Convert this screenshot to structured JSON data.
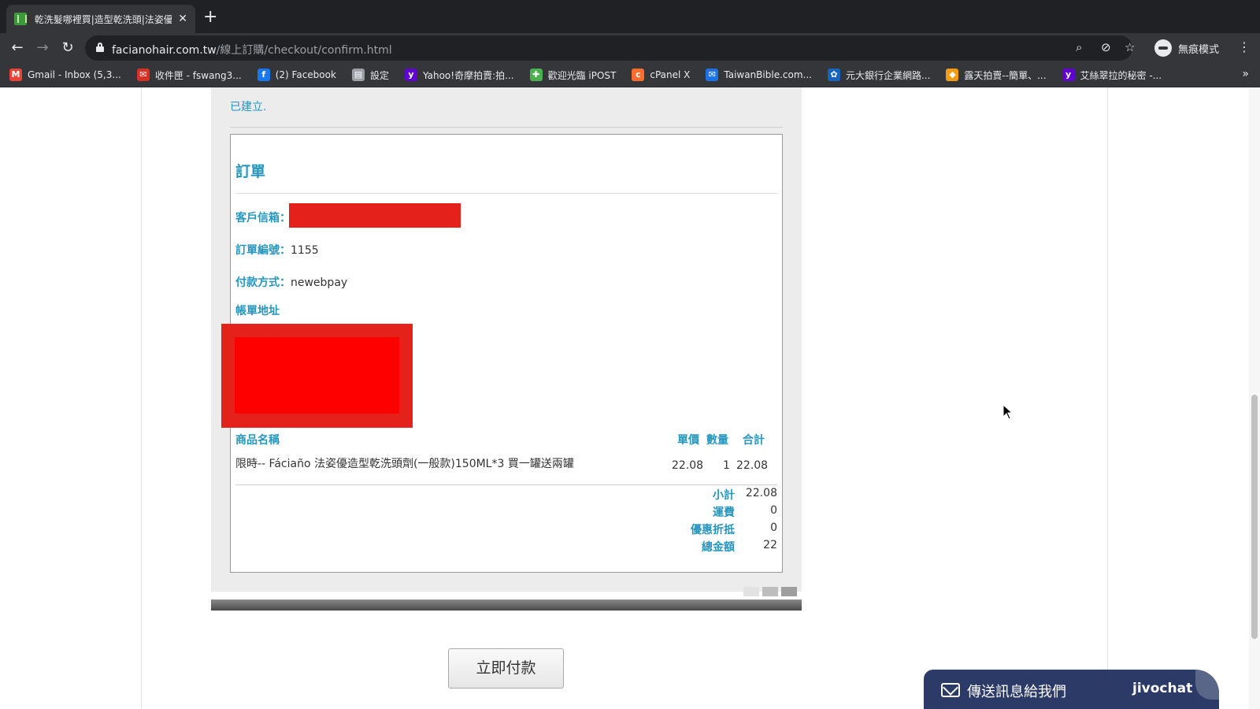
{
  "browser": {
    "tab": {
      "title": "乾洗髮哪裡買|造型乾洗頭|法姿優",
      "close": "✕"
    },
    "new_tab": "+",
    "url": {
      "host": "facianohair.com.tw",
      "path": "/線上訂購/checkout/confirm.html"
    },
    "profile_label": "無痕模式",
    "bookmarks": [
      {
        "label": "Gmail - Inbox (5,3...",
        "icon": "gmail-icon",
        "color": "#ea4335",
        "glyph": "M"
      },
      {
        "label": "收件匣 - fswang3...",
        "icon": "mail-icon",
        "color": "#d93025",
        "glyph": "✉"
      },
      {
        "label": "(2) Facebook",
        "icon": "facebook-icon",
        "color": "#1877f2",
        "glyph": "f"
      },
      {
        "label": "設定",
        "icon": "printer-icon",
        "color": "#9aa0a6",
        "glyph": "▤"
      },
      {
        "label": "Yahoo!奇摩拍賣:拍...",
        "icon": "yahoo-icon",
        "color": "#6001d2",
        "glyph": "y"
      },
      {
        "label": "歡迎光臨 iPOST",
        "icon": "ipost-icon",
        "color": "#4caf50",
        "glyph": "✚"
      },
      {
        "label": "cPanel X",
        "icon": "cpanel-icon",
        "color": "#ff6c2c",
        "glyph": "c"
      },
      {
        "label": "TaiwanBible.com...",
        "icon": "taiwanbible-icon",
        "color": "#1a73e8",
        "glyph": "✉"
      },
      {
        "label": "元大銀行企業網路...",
        "icon": "bank-icon",
        "color": "#1565c0",
        "glyph": "✿"
      },
      {
        "label": "露天拍賣--簡單、...",
        "icon": "ruten-icon",
        "color": "#f39c12",
        "glyph": "◆"
      },
      {
        "label": "艾絲翠拉的秘密 -...",
        "icon": "yahoo-icon",
        "color": "#6001d2",
        "glyph": "y"
      }
    ]
  },
  "page": {
    "status_text": "已建立.",
    "order": {
      "title": "訂單",
      "email_label": "客戶信箱：",
      "order_no_label": "訂單編號：",
      "order_no": "1155",
      "payment_label": "付款方式：",
      "payment": "newebpay",
      "billing_label": "帳單地址"
    },
    "table": {
      "headers": {
        "name": "商品名稱",
        "price": "單價",
        "qty": "數量",
        "total": "合計"
      },
      "items": [
        {
          "name": "限時-- Fáciaño 法姿優造型乾洗頭劑(一般款)150ML*3 買一罐送兩罐",
          "price": "22.08",
          "qty": "1",
          "total": "22.08"
        }
      ],
      "summary": [
        {
          "label": "小計",
          "value": "22.08"
        },
        {
          "label": "運費",
          "value": "0"
        },
        {
          "label": "優惠折抵",
          "value": "0"
        },
        {
          "label": "總金額",
          "value": "22"
        }
      ]
    },
    "pay_button": "立即付款",
    "chat": {
      "label": "傳送訊息給我們",
      "brand": "jivochat"
    }
  },
  "colors": {
    "accent": "#2596be",
    "redaction": "#e5211c",
    "chat_bg": "#2b3a67"
  }
}
